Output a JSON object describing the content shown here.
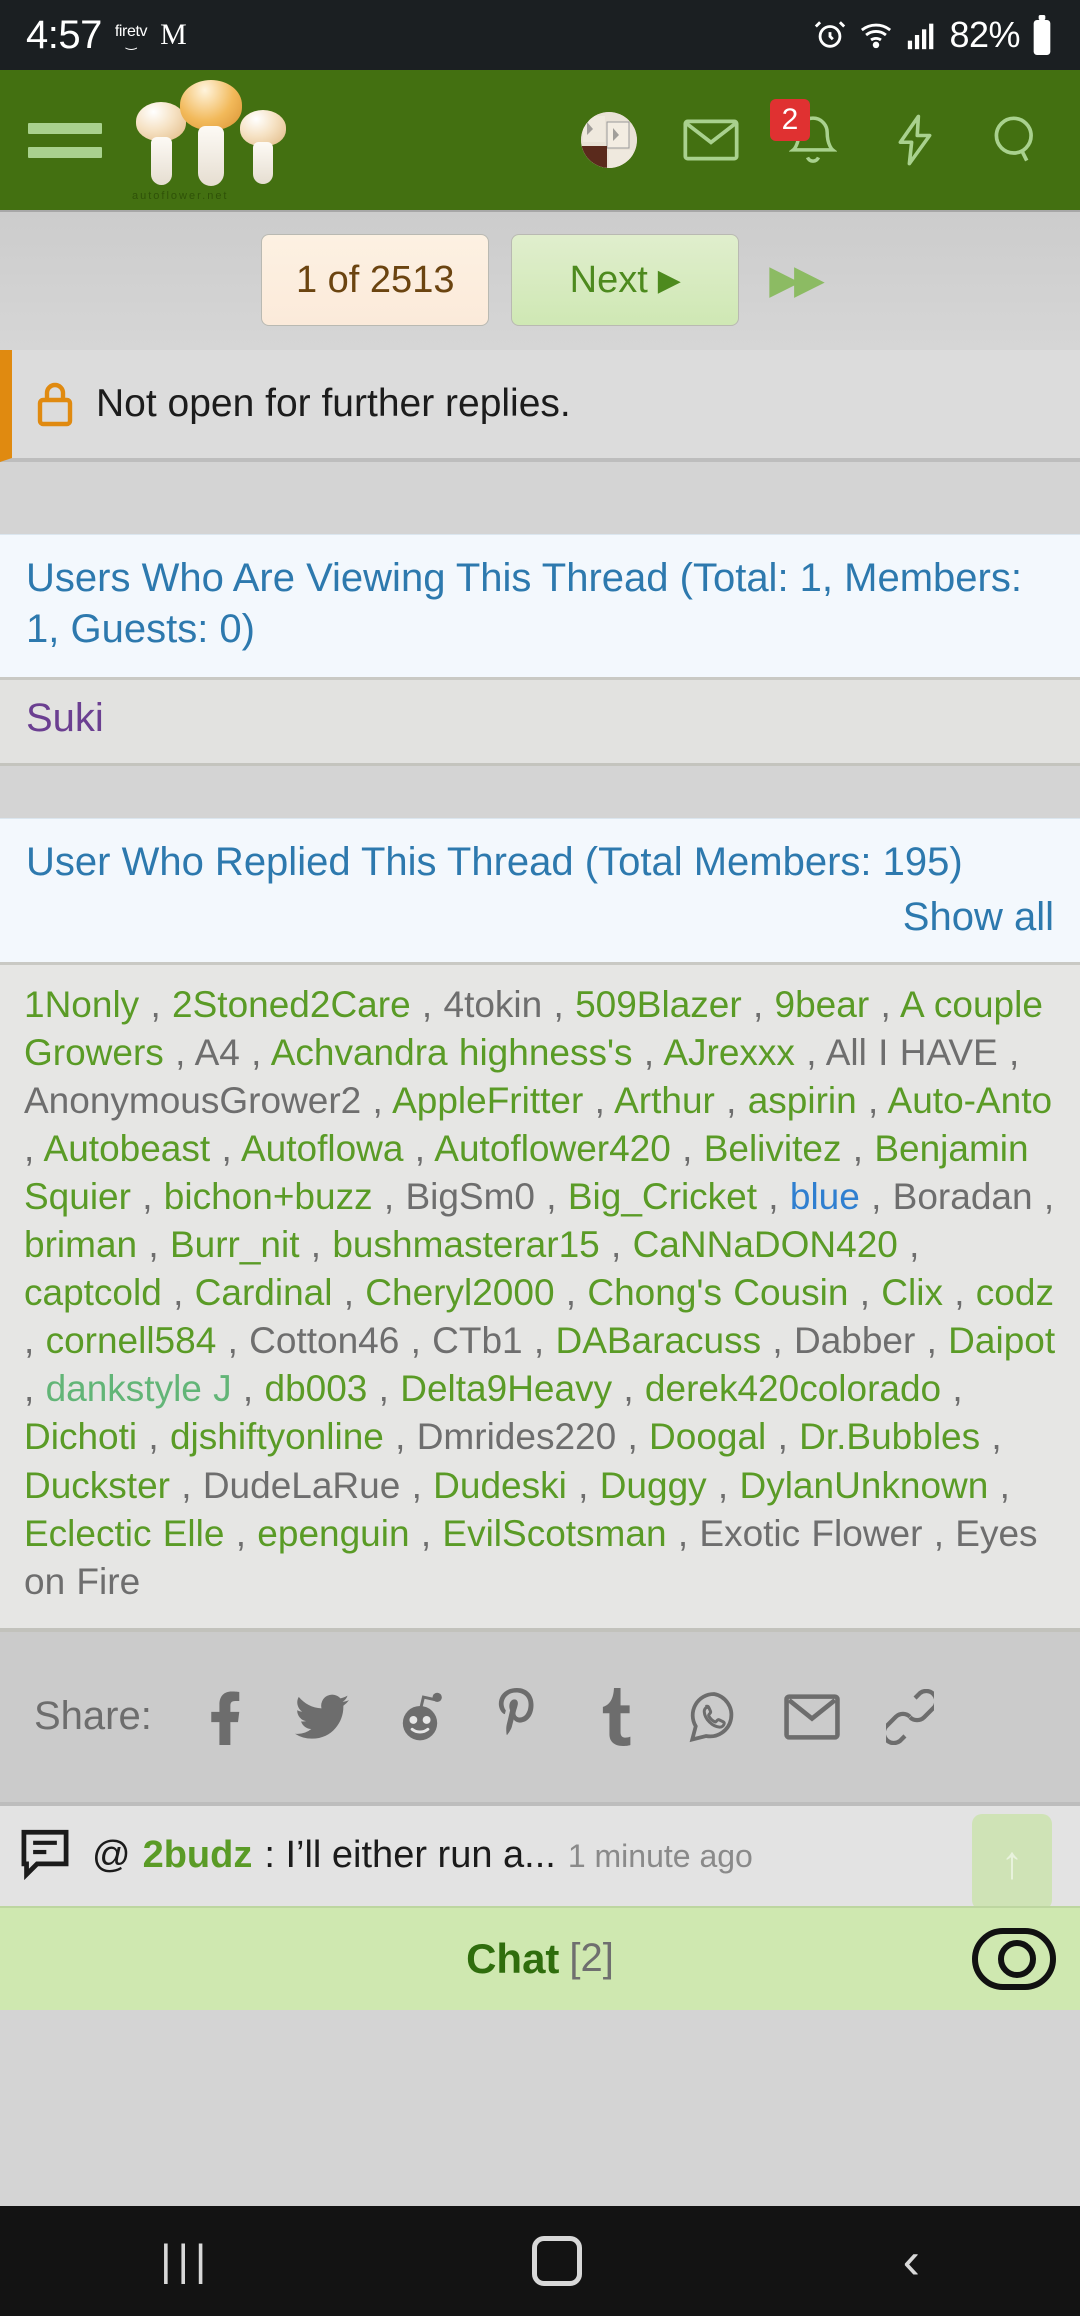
{
  "status_bar": {
    "time": "4:57",
    "firetv_label": "firetv",
    "gmail_icon": "M",
    "alarm_icon": "alarm-icon",
    "wifi_icon": "wifi-icon",
    "signal_icon": "cellular-signal-icon",
    "battery_percent": "82%",
    "battery_icon": "battery-icon"
  },
  "navbar": {
    "menu_icon": "hamburger-menu-icon",
    "brand_url": "autoflower.net",
    "avatar_icon": "user-avatar",
    "inbox_icon": "envelope-icon",
    "alerts_icon": "bell-icon",
    "alerts_badge": "2",
    "bolt_icon": "lightning-bolt-icon",
    "search_icon": "search-icon"
  },
  "pagination": {
    "current_label": "1 of 2513",
    "next_label": "Next",
    "next_caret": "▶",
    "fast_forward": "▶▶"
  },
  "notice": {
    "lock_icon": "lock-icon",
    "text": "Not open for further replies."
  },
  "viewing_panel": {
    "title": "Users Who Are Viewing This Thread (Total: 1, Members: 1, Guests: 0)",
    "viewers": [
      "Suki"
    ]
  },
  "replied_panel": {
    "title": "User Who Replied This Thread (Total Members: 195)",
    "show_all_label": "Show all",
    "separator": " , ",
    "members": [
      {
        "name": "1Nonly",
        "style": "green"
      },
      {
        "name": "2Stoned2Care",
        "style": "green"
      },
      {
        "name": "4tokin",
        "style": "gray"
      },
      {
        "name": "509Blazer",
        "style": "green"
      },
      {
        "name": "9bear",
        "style": "green"
      },
      {
        "name": "A couple Growers",
        "style": "green"
      },
      {
        "name": "A4",
        "style": "gray"
      },
      {
        "name": "Achvandra highness's",
        "style": "green"
      },
      {
        "name": "AJrexxx",
        "style": "green"
      },
      {
        "name": "All I HAVE",
        "style": "gray"
      },
      {
        "name": "AnonymousGrower2",
        "style": "gray"
      },
      {
        "name": "AppleFritter",
        "style": "green"
      },
      {
        "name": "Arthur",
        "style": "green"
      },
      {
        "name": "aspirin",
        "style": "green"
      },
      {
        "name": "Auto-Anto",
        "style": "green"
      },
      {
        "name": "Autobeast",
        "style": "green"
      },
      {
        "name": "Autoflowa",
        "style": "green"
      },
      {
        "name": "Autoflower420",
        "style": "green"
      },
      {
        "name": "Belivitez",
        "style": "green"
      },
      {
        "name": "Benjamin Squier",
        "style": "green"
      },
      {
        "name": "bichon+buzz",
        "style": "green"
      },
      {
        "name": "BigSm0",
        "style": "gray"
      },
      {
        "name": "Big_Cricket",
        "style": "green"
      },
      {
        "name": "blue",
        "style": "blue"
      },
      {
        "name": "Boradan",
        "style": "gray"
      },
      {
        "name": "briman",
        "style": "green"
      },
      {
        "name": "Burr_nit",
        "style": "green"
      },
      {
        "name": "bushmasterar15",
        "style": "green"
      },
      {
        "name": "CaNNaDON420",
        "style": "green"
      },
      {
        "name": "captcold",
        "style": "green"
      },
      {
        "name": "Cardinal",
        "style": "green"
      },
      {
        "name": "Cheryl2000",
        "style": "green"
      },
      {
        "name": "Chong's Cousin",
        "style": "green"
      },
      {
        "name": "Clix",
        "style": "green"
      },
      {
        "name": "codz",
        "style": "green"
      },
      {
        "name": "cornell584",
        "style": "green"
      },
      {
        "name": "Cotton46",
        "style": "gray"
      },
      {
        "name": "CTb1",
        "style": "gray"
      },
      {
        "name": "DABaracuss",
        "style": "green"
      },
      {
        "name": "Dabber",
        "style": "gray"
      },
      {
        "name": "Daipot",
        "style": "green"
      },
      {
        "name": "dankstyle J",
        "style": "ltgreen"
      },
      {
        "name": "db003",
        "style": "green"
      },
      {
        "name": "Delta9Heavy",
        "style": "green"
      },
      {
        "name": "derek420colorado",
        "style": "green"
      },
      {
        "name": "Dichoti",
        "style": "green"
      },
      {
        "name": "djshiftyonline",
        "style": "green"
      },
      {
        "name": "Dmrides220",
        "style": "gray"
      },
      {
        "name": "Doogal",
        "style": "green"
      },
      {
        "name": "Dr.Bubbles",
        "style": "green"
      },
      {
        "name": "Duckster",
        "style": "green"
      },
      {
        "name": "DudeLaRue",
        "style": "gray"
      },
      {
        "name": "Dudeski",
        "style": "green"
      },
      {
        "name": "Duggy",
        "style": "green"
      },
      {
        "name": "DylanUnknown",
        "style": "green"
      },
      {
        "name": "Eclectic Elle",
        "style": "green"
      },
      {
        "name": "epenguin",
        "style": "green"
      },
      {
        "name": "EvilScotsman",
        "style": "green"
      },
      {
        "name": "Exotic Flower",
        "style": "gray"
      },
      {
        "name": "Eyes on Fire",
        "style": "gray"
      }
    ]
  },
  "share": {
    "label": "Share:",
    "icons": [
      "facebook-icon",
      "twitter-icon",
      "reddit-icon",
      "pinterest-icon",
      "tumblr-icon",
      "whatsapp-icon",
      "email-icon",
      "link-icon"
    ]
  },
  "chat": {
    "message_icon": "chat-bubble-icon",
    "at_symbol": "@",
    "username": "2budz",
    "colon": ":",
    "message": "I’ll either run a...",
    "timestamp": "1 minute ago",
    "scroll_up_icon": "arrow-up-icon",
    "title": "Chat",
    "count": "[2]",
    "toggle_icon": "toggle-switch"
  },
  "android_nav": {
    "recents_icon": "|||",
    "home_icon": "home-square-icon",
    "back_icon": "‹"
  },
  "colors": {
    "brand_green": "#437011",
    "link_green": "#5a9b26",
    "link_blue": "#2d79ae",
    "badge_red": "#e03131",
    "notice_orange": "#e08a10",
    "viewer_purple": "#6b3f91"
  }
}
